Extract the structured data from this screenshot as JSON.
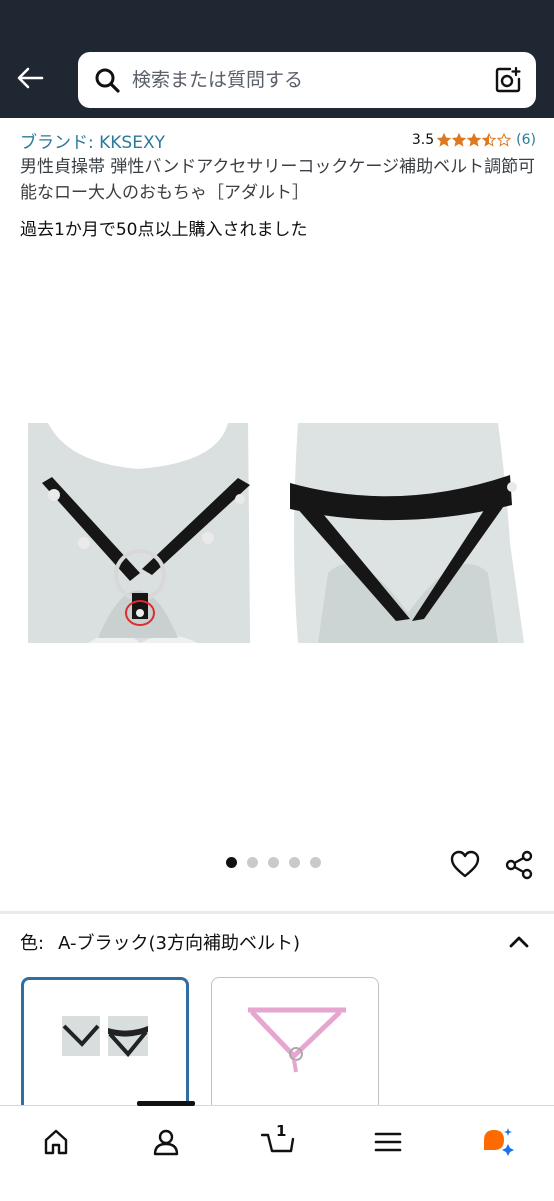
{
  "search": {
    "placeholder": "検索または質問する"
  },
  "product": {
    "brand": "ブランド: KKSEXY",
    "rating": "3.5",
    "stars_filled": 3.5,
    "stars_total": 5,
    "rating_count": "(6)",
    "title": "男性貞操帯 弾性バンドアクセサリーコックケージ補助ベルト調節可能なロー大人のおもちゃ［アダルト］",
    "purchase_note": "過去1か月で50点以上購入されました"
  },
  "gallery": {
    "image_count": 5,
    "active_index": 0
  },
  "variation": {
    "label": "色:",
    "value": "A-ブラック(3方向補助ベルト)"
  },
  "nav": {
    "cart_count": "1"
  },
  "colors": {
    "topbar": "#1f2733",
    "link": "#2b7a98",
    "star": "#de7921",
    "selected_border": "#2f6ea3",
    "account_icon": "#ff6a00",
    "account_dot": "#1a73e8"
  }
}
